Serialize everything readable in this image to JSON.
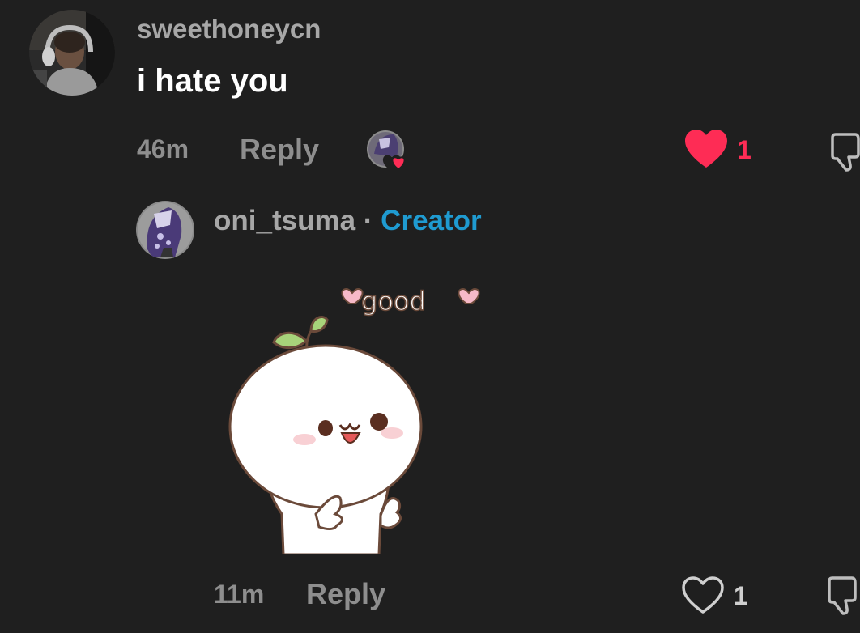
{
  "comment": {
    "username": "sweethoneycn",
    "text": "i hate you",
    "time": "46m",
    "reply_label": "Reply",
    "like_count": "1",
    "liked": true,
    "liked_by_creator": true
  },
  "reply": {
    "username": "oni_tsuma",
    "separator": "·",
    "creator_label": "Creator",
    "sticker": {
      "caption": "good",
      "description": "white round mochi character with sprout giving thumbs up"
    },
    "time": "11m",
    "reply_label": "Reply",
    "like_count": "1",
    "liked": false
  },
  "colors": {
    "background": "#1f1f1f",
    "like_red": "#fe2c55",
    "creator_blue": "#1f9bd1",
    "muted": "#8e8e8e"
  },
  "icons": {
    "like": "heart-icon",
    "like_outline": "heart-outline-icon",
    "dislike": "thumbs-down-icon",
    "creator_liked": "creator-liked-badge-icon"
  }
}
